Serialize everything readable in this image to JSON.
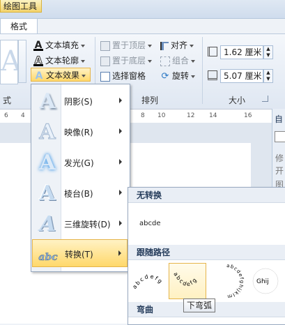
{
  "ribbon": {
    "context_tab": "绘图工具",
    "tab": "格式",
    "text_group": {
      "fill": "文本填充",
      "outline": "文本轮廓",
      "effects": "文本效果"
    },
    "arrange_group": {
      "bring_front": "置于顶层",
      "send_back": "置于底层",
      "selection_pane": "选择窗格",
      "align": "对齐",
      "group": "组合",
      "rotate": "旋转",
      "label": "排列"
    },
    "size_group": {
      "height": "1.62 厘米",
      "width": "5.07 厘米",
      "label": "大小"
    },
    "left_group_label": "式"
  },
  "ruler": {
    "ticks": [
      "6",
      "4",
      "2",
      "2",
      "4",
      "6",
      "8",
      "10",
      "12",
      "14",
      "16"
    ]
  },
  "effects_menu": {
    "items": [
      {
        "label": "阴影(S)",
        "icon": "shadow-a-icon"
      },
      {
        "label": "映像(R)",
        "icon": "reflection-a-icon"
      },
      {
        "label": "发光(G)",
        "icon": "glow-a-icon"
      },
      {
        "label": "棱台(B)",
        "icon": "bevel-a-icon"
      },
      {
        "label": "三维旋转(D)",
        "icon": "3d-rotation-a-icon"
      },
      {
        "label": "转换(T)",
        "icon": "transform-abc-icon"
      }
    ]
  },
  "transform_submenu": {
    "no_transform_header": "无转换",
    "no_transform_sample": "abcde",
    "follow_path_header": "跟随路径",
    "path_samples": [
      "abcdefg",
      "abcdefg",
      "abcdefghijklm",
      "Ghij"
    ],
    "warp_header": "弯曲",
    "tooltip": "下弯弧"
  },
  "right_pane": {
    "label": "自",
    "side_text": [
      "修",
      "开",
      "图"
    ]
  },
  "colors": {
    "accent": "#2b78c4",
    "highlight": "#ffd86b"
  }
}
